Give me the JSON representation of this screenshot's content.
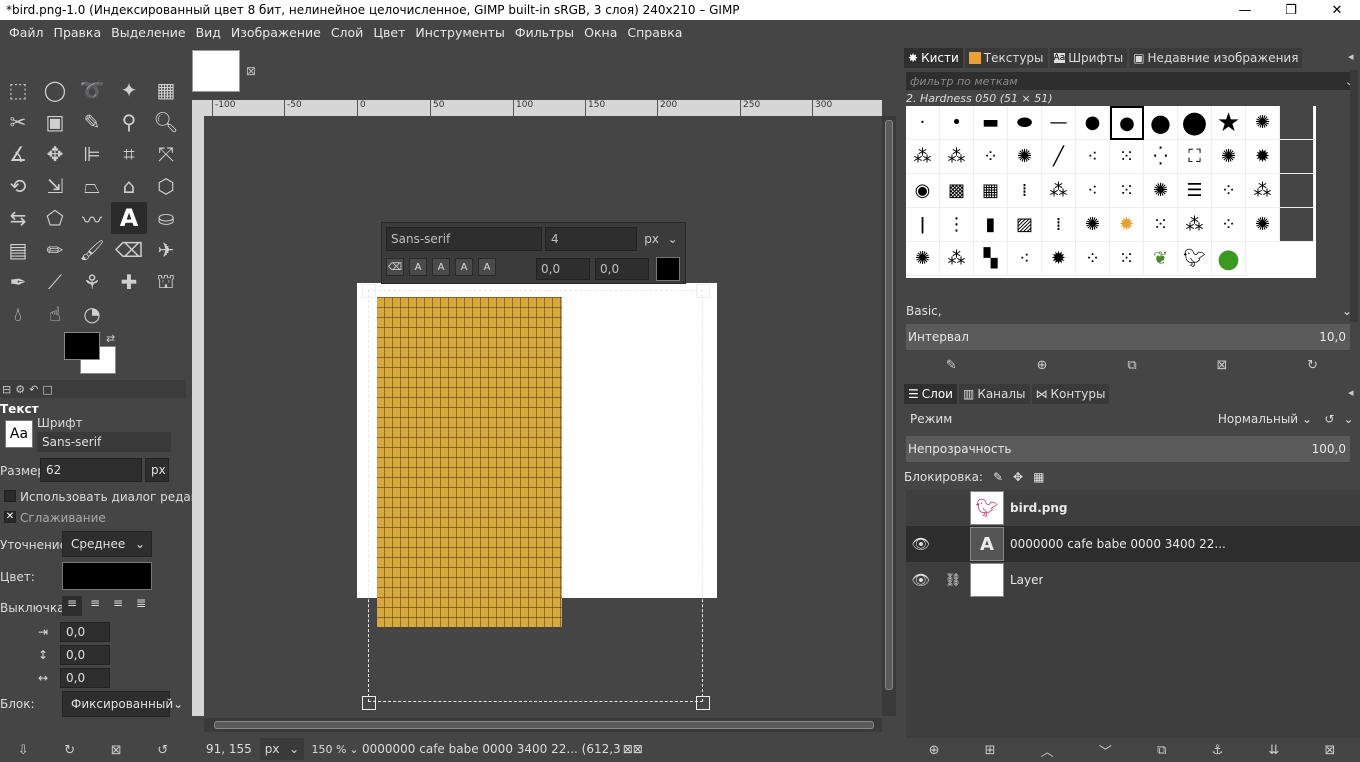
{
  "window": {
    "title": "*bird.png-1.0 (Индексированный цвет 8 бит, нелинейное целочисленное, GIMP built-in sRGB, 3 слоя) 240x210 – GIMP"
  },
  "menu": [
    "Файл",
    "Правка",
    "Выделение",
    "Вид",
    "Изображение",
    "Слой",
    "Цвет",
    "Инструменты",
    "Фильтры",
    "Окна",
    "Справка"
  ],
  "tool_options": {
    "title": "Текст",
    "font_label": "Шрифт",
    "font_value": "Sans-serif",
    "font_preview": "Aa",
    "size_label": "Размер:",
    "size_value": "62",
    "size_unit": "px",
    "use_editor_label": "Использовать диалог редакт",
    "antialias_label": "Сглаживание",
    "hinting_label": "Уточнение:",
    "hinting_value": "Среднее",
    "color_label": "Цвет:",
    "justify_label": "Выключка:",
    "indent_value": "0,0",
    "linespacing_value": "0,0",
    "letterspacing_value": "0,0",
    "box_label": "Блок:",
    "box_value": "Фиксированный"
  },
  "ruler_labels": [
    "-100",
    "-50",
    "0",
    "50",
    "100",
    "150",
    "200",
    "250",
    "300"
  ],
  "text_style_editor": {
    "font": "Sans-serif",
    "size": "4",
    "unit": "px",
    "baseline": "0,0",
    "kerning": "0,0"
  },
  "status": {
    "coords": "91, 155",
    "unit": "px",
    "zoom": "150 %",
    "message": "0000000 cafe babe 0000 3400 22... (612,3"
  },
  "dock": {
    "tabs_top": [
      "Кисти",
      "Текстуры",
      "Шрифты",
      "Недавние изображения"
    ],
    "filter_placeholder": "фильтр по меткам",
    "brush_name": "2. Hardness 050 (51 × 51)",
    "preset": "Basic,",
    "interval_label": "Интервал",
    "interval_value": "10,0",
    "tabs_layers": [
      "Слои",
      "Каналы",
      "Контуры"
    ],
    "mode_label": "Режим",
    "mode_value": "Нормальный",
    "opacity_label": "Непрозрачность",
    "opacity_value": "100,0",
    "lock_label": "Блокировка:",
    "layers": [
      {
        "name": "bird.png",
        "visible": false,
        "bold": true
      },
      {
        "name": "0000000 cafe babe 0000 3400 22...",
        "visible": true,
        "bold": false
      },
      {
        "name": "Layer",
        "visible": true,
        "bold": false
      }
    ]
  }
}
